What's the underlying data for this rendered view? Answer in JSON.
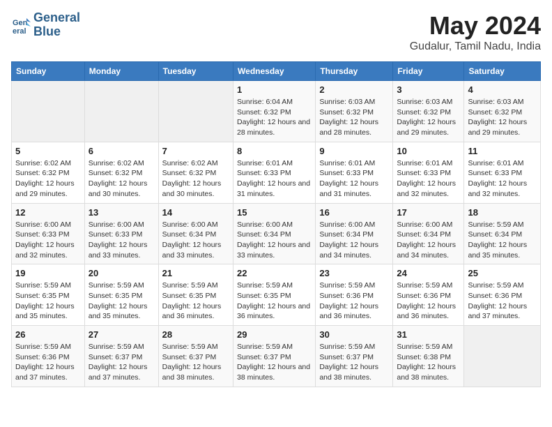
{
  "logo": {
    "line1": "General",
    "line2": "Blue"
  },
  "title": "May 2024",
  "subtitle": "Gudalur, Tamil Nadu, India",
  "days_header": [
    "Sunday",
    "Monday",
    "Tuesday",
    "Wednesday",
    "Thursday",
    "Friday",
    "Saturday"
  ],
  "weeks": [
    [
      {
        "day": "",
        "sunrise": "",
        "sunset": "",
        "daylight": ""
      },
      {
        "day": "",
        "sunrise": "",
        "sunset": "",
        "daylight": ""
      },
      {
        "day": "",
        "sunrise": "",
        "sunset": "",
        "daylight": ""
      },
      {
        "day": "1",
        "sunrise": "Sunrise: 6:04 AM",
        "sunset": "Sunset: 6:32 PM",
        "daylight": "Daylight: 12 hours and 28 minutes."
      },
      {
        "day": "2",
        "sunrise": "Sunrise: 6:03 AM",
        "sunset": "Sunset: 6:32 PM",
        "daylight": "Daylight: 12 hours and 28 minutes."
      },
      {
        "day": "3",
        "sunrise": "Sunrise: 6:03 AM",
        "sunset": "Sunset: 6:32 PM",
        "daylight": "Daylight: 12 hours and 29 minutes."
      },
      {
        "day": "4",
        "sunrise": "Sunrise: 6:03 AM",
        "sunset": "Sunset: 6:32 PM",
        "daylight": "Daylight: 12 hours and 29 minutes."
      }
    ],
    [
      {
        "day": "5",
        "sunrise": "Sunrise: 6:02 AM",
        "sunset": "Sunset: 6:32 PM",
        "daylight": "Daylight: 12 hours and 29 minutes."
      },
      {
        "day": "6",
        "sunrise": "Sunrise: 6:02 AM",
        "sunset": "Sunset: 6:32 PM",
        "daylight": "Daylight: 12 hours and 30 minutes."
      },
      {
        "day": "7",
        "sunrise": "Sunrise: 6:02 AM",
        "sunset": "Sunset: 6:32 PM",
        "daylight": "Daylight: 12 hours and 30 minutes."
      },
      {
        "day": "8",
        "sunrise": "Sunrise: 6:01 AM",
        "sunset": "Sunset: 6:33 PM",
        "daylight": "Daylight: 12 hours and 31 minutes."
      },
      {
        "day": "9",
        "sunrise": "Sunrise: 6:01 AM",
        "sunset": "Sunset: 6:33 PM",
        "daylight": "Daylight: 12 hours and 31 minutes."
      },
      {
        "day": "10",
        "sunrise": "Sunrise: 6:01 AM",
        "sunset": "Sunset: 6:33 PM",
        "daylight": "Daylight: 12 hours and 32 minutes."
      },
      {
        "day": "11",
        "sunrise": "Sunrise: 6:01 AM",
        "sunset": "Sunset: 6:33 PM",
        "daylight": "Daylight: 12 hours and 32 minutes."
      }
    ],
    [
      {
        "day": "12",
        "sunrise": "Sunrise: 6:00 AM",
        "sunset": "Sunset: 6:33 PM",
        "daylight": "Daylight: 12 hours and 32 minutes."
      },
      {
        "day": "13",
        "sunrise": "Sunrise: 6:00 AM",
        "sunset": "Sunset: 6:33 PM",
        "daylight": "Daylight: 12 hours and 33 minutes."
      },
      {
        "day": "14",
        "sunrise": "Sunrise: 6:00 AM",
        "sunset": "Sunset: 6:34 PM",
        "daylight": "Daylight: 12 hours and 33 minutes."
      },
      {
        "day": "15",
        "sunrise": "Sunrise: 6:00 AM",
        "sunset": "Sunset: 6:34 PM",
        "daylight": "Daylight: 12 hours and 33 minutes."
      },
      {
        "day": "16",
        "sunrise": "Sunrise: 6:00 AM",
        "sunset": "Sunset: 6:34 PM",
        "daylight": "Daylight: 12 hours and 34 minutes."
      },
      {
        "day": "17",
        "sunrise": "Sunrise: 6:00 AM",
        "sunset": "Sunset: 6:34 PM",
        "daylight": "Daylight: 12 hours and 34 minutes."
      },
      {
        "day": "18",
        "sunrise": "Sunrise: 5:59 AM",
        "sunset": "Sunset: 6:34 PM",
        "daylight": "Daylight: 12 hours and 35 minutes."
      }
    ],
    [
      {
        "day": "19",
        "sunrise": "Sunrise: 5:59 AM",
        "sunset": "Sunset: 6:35 PM",
        "daylight": "Daylight: 12 hours and 35 minutes."
      },
      {
        "day": "20",
        "sunrise": "Sunrise: 5:59 AM",
        "sunset": "Sunset: 6:35 PM",
        "daylight": "Daylight: 12 hours and 35 minutes."
      },
      {
        "day": "21",
        "sunrise": "Sunrise: 5:59 AM",
        "sunset": "Sunset: 6:35 PM",
        "daylight": "Daylight: 12 hours and 36 minutes."
      },
      {
        "day": "22",
        "sunrise": "Sunrise: 5:59 AM",
        "sunset": "Sunset: 6:35 PM",
        "daylight": "Daylight: 12 hours and 36 minutes."
      },
      {
        "day": "23",
        "sunrise": "Sunrise: 5:59 AM",
        "sunset": "Sunset: 6:36 PM",
        "daylight": "Daylight: 12 hours and 36 minutes."
      },
      {
        "day": "24",
        "sunrise": "Sunrise: 5:59 AM",
        "sunset": "Sunset: 6:36 PM",
        "daylight": "Daylight: 12 hours and 36 minutes."
      },
      {
        "day": "25",
        "sunrise": "Sunrise: 5:59 AM",
        "sunset": "Sunset: 6:36 PM",
        "daylight": "Daylight: 12 hours and 37 minutes."
      }
    ],
    [
      {
        "day": "26",
        "sunrise": "Sunrise: 5:59 AM",
        "sunset": "Sunset: 6:36 PM",
        "daylight": "Daylight: 12 hours and 37 minutes."
      },
      {
        "day": "27",
        "sunrise": "Sunrise: 5:59 AM",
        "sunset": "Sunset: 6:37 PM",
        "daylight": "Daylight: 12 hours and 37 minutes."
      },
      {
        "day": "28",
        "sunrise": "Sunrise: 5:59 AM",
        "sunset": "Sunset: 6:37 PM",
        "daylight": "Daylight: 12 hours and 38 minutes."
      },
      {
        "day": "29",
        "sunrise": "Sunrise: 5:59 AM",
        "sunset": "Sunset: 6:37 PM",
        "daylight": "Daylight: 12 hours and 38 minutes."
      },
      {
        "day": "30",
        "sunrise": "Sunrise: 5:59 AM",
        "sunset": "Sunset: 6:37 PM",
        "daylight": "Daylight: 12 hours and 38 minutes."
      },
      {
        "day": "31",
        "sunrise": "Sunrise: 5:59 AM",
        "sunset": "Sunset: 6:38 PM",
        "daylight": "Daylight: 12 hours and 38 minutes."
      },
      {
        "day": "",
        "sunrise": "",
        "sunset": "",
        "daylight": ""
      }
    ]
  ]
}
